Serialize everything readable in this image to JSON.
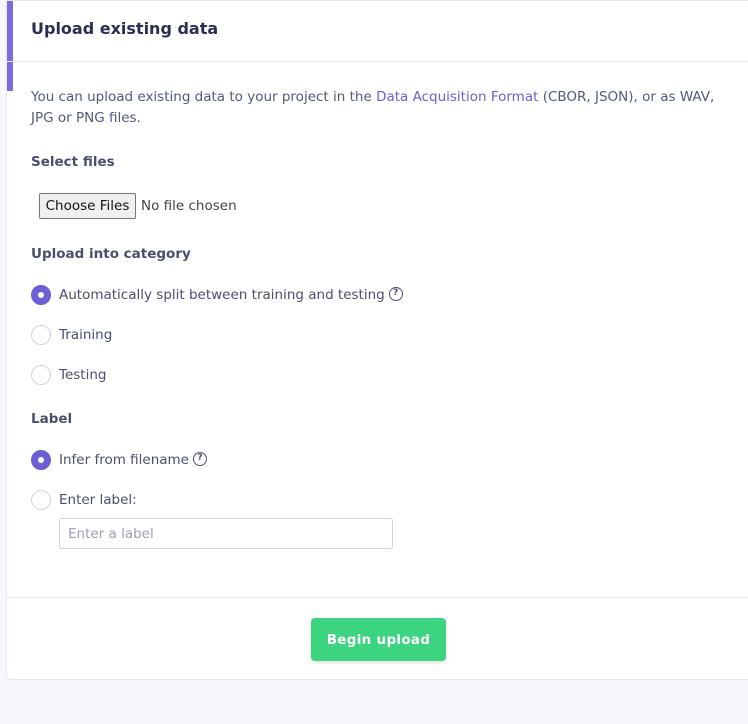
{
  "header": {
    "title": "Upload existing data"
  },
  "intro": {
    "prefix": "You can upload existing data to your project in the ",
    "link": "Data Acquisition Format",
    "suffix": " (CBOR, JSON), or as WAV, JPG or PNG files."
  },
  "select_files": {
    "label": "Select files",
    "button": "Choose Files",
    "status": "No file chosen"
  },
  "category": {
    "label": "Upload into category",
    "options": [
      {
        "label": "Automatically split between training and testing",
        "checked": true,
        "help": true
      },
      {
        "label": "Training",
        "checked": false
      },
      {
        "label": "Testing",
        "checked": false
      }
    ]
  },
  "label_section": {
    "label": "Label",
    "options": [
      {
        "label": "Infer from filename",
        "checked": true,
        "help": true
      },
      {
        "label": "Enter label:",
        "checked": false
      }
    ],
    "input_placeholder": "Enter a label"
  },
  "actions": {
    "begin_upload": "Begin upload"
  },
  "colors": {
    "accent": "#6b5fd3",
    "primary_button": "#3dd47f"
  }
}
